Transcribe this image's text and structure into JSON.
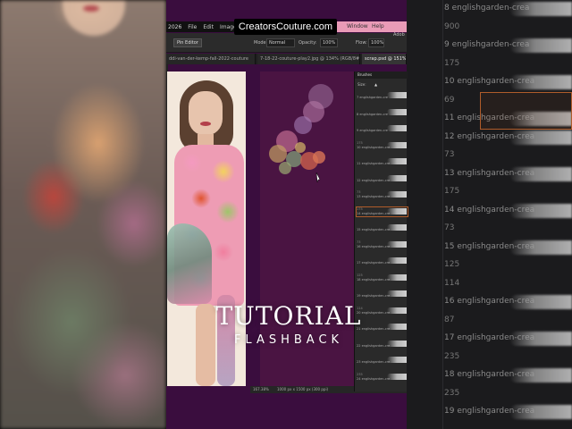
{
  "logo": {
    "text": "CreatorsCouture.com"
  },
  "menubar": {
    "year": "2026",
    "items": [
      "File",
      "Edit",
      "Image",
      "L",
      "Window",
      "Help"
    ]
  },
  "options_bar": {
    "pin_edit": "Pin Editor",
    "mode_label": "Mode:",
    "mode_value": "Normal",
    "opacity_label": "Opacity:",
    "opacity_value": "100%",
    "flow_label": "Flow:",
    "flow_value": "100%",
    "right_label": "Adob"
  },
  "doc_tabs": [
    "ddi-van-der-kemp-fall-2022-couture",
    "7-18-22-couture-play2.jpg @ 134% (RGB/8#)",
    "scrap.psd @ 151% (La"
  ],
  "status_bar": {
    "zoom": "167.38%",
    "size": "1000 px x 1500 px (300 ppi)"
  },
  "brushes_panel": {
    "title": "Brushes",
    "size_label": "Size:",
    "items": [
      {
        "num": "",
        "name": "7 englishgarden-cre"
      },
      {
        "num": "",
        "name": "8 englishgarden-cre"
      },
      {
        "num": "",
        "name": "9 englishgarden-cre"
      },
      {
        "num": "175",
        "name": "10 englishgarden-cre"
      },
      {
        "num": "",
        "name": "11 englishgarden-cre"
      },
      {
        "num": "",
        "name": "12 englishgarden-cre"
      },
      {
        "num": "73",
        "name": "13 englishgarden-cre"
      },
      {
        "num": "175",
        "name": "14 englishgarden-cre"
      },
      {
        "num": "",
        "name": "15 englishgarden-cre"
      },
      {
        "num": "73",
        "name": "16 englishgarden-cre"
      },
      {
        "num": "",
        "name": "17 englishgarden-cre"
      },
      {
        "num": "125",
        "name": "18 englishgarden-cre"
      },
      {
        "num": "",
        "name": "19 englishgarden-cre"
      },
      {
        "num": "114",
        "name": "20 englishgarden-cre"
      },
      {
        "num": "",
        "name": "21 englishgarden-cre"
      },
      {
        "num": "",
        "name": "22 englishgarden-cre"
      },
      {
        "num": "",
        "name": "23 englishgarden-cre"
      },
      {
        "num": "235",
        "name": "24 englishgarden-cre"
      }
    ]
  },
  "right_overlay": {
    "rows": [
      {
        "num": "",
        "name": "8 englishgarden-crea"
      },
      {
        "num": "900",
        "name": ""
      },
      {
        "num": "",
        "name": "9 englishgarden-crea"
      },
      {
        "num": "175",
        "name": ""
      },
      {
        "num": "",
        "name": "10 englishgarden-crea"
      },
      {
        "num": "69",
        "name": ""
      },
      {
        "num": "",
        "name": "11 englishgarden-crea"
      },
      {
        "num": "",
        "name": "12 englishgarden-crea"
      },
      {
        "num": "73",
        "name": ""
      },
      {
        "num": "",
        "name": "13 englishgarden-crea"
      },
      {
        "num": "175",
        "name": ""
      },
      {
        "num": "",
        "name": "14 englishgarden-crea"
      },
      {
        "num": "73",
        "name": ""
      },
      {
        "num": "",
        "name": "15 englishgarden-crea"
      },
      {
        "num": "125",
        "name": ""
      },
      {
        "num": "114",
        "name": ""
      },
      {
        "num": "",
        "name": "16 englishgarden-crea"
      },
      {
        "num": "87",
        "name": ""
      },
      {
        "num": "",
        "name": "17 englishgarden-crea"
      },
      {
        "num": "235",
        "name": ""
      },
      {
        "num": "",
        "name": "18 englishgarden-crea"
      },
      {
        "num": "235",
        "name": ""
      },
      {
        "num": "",
        "name": "19 englishgarden-crea"
      }
    ]
  },
  "overlay_title": {
    "line1": "TUTORIAL",
    "line2": "FLASHBACK"
  },
  "colors": {
    "background_purple": "#3a0d3e",
    "canvas_purple": "#4a1442",
    "menubar_pink": "#e99bb7",
    "selection_orange": "#b05c2a"
  }
}
